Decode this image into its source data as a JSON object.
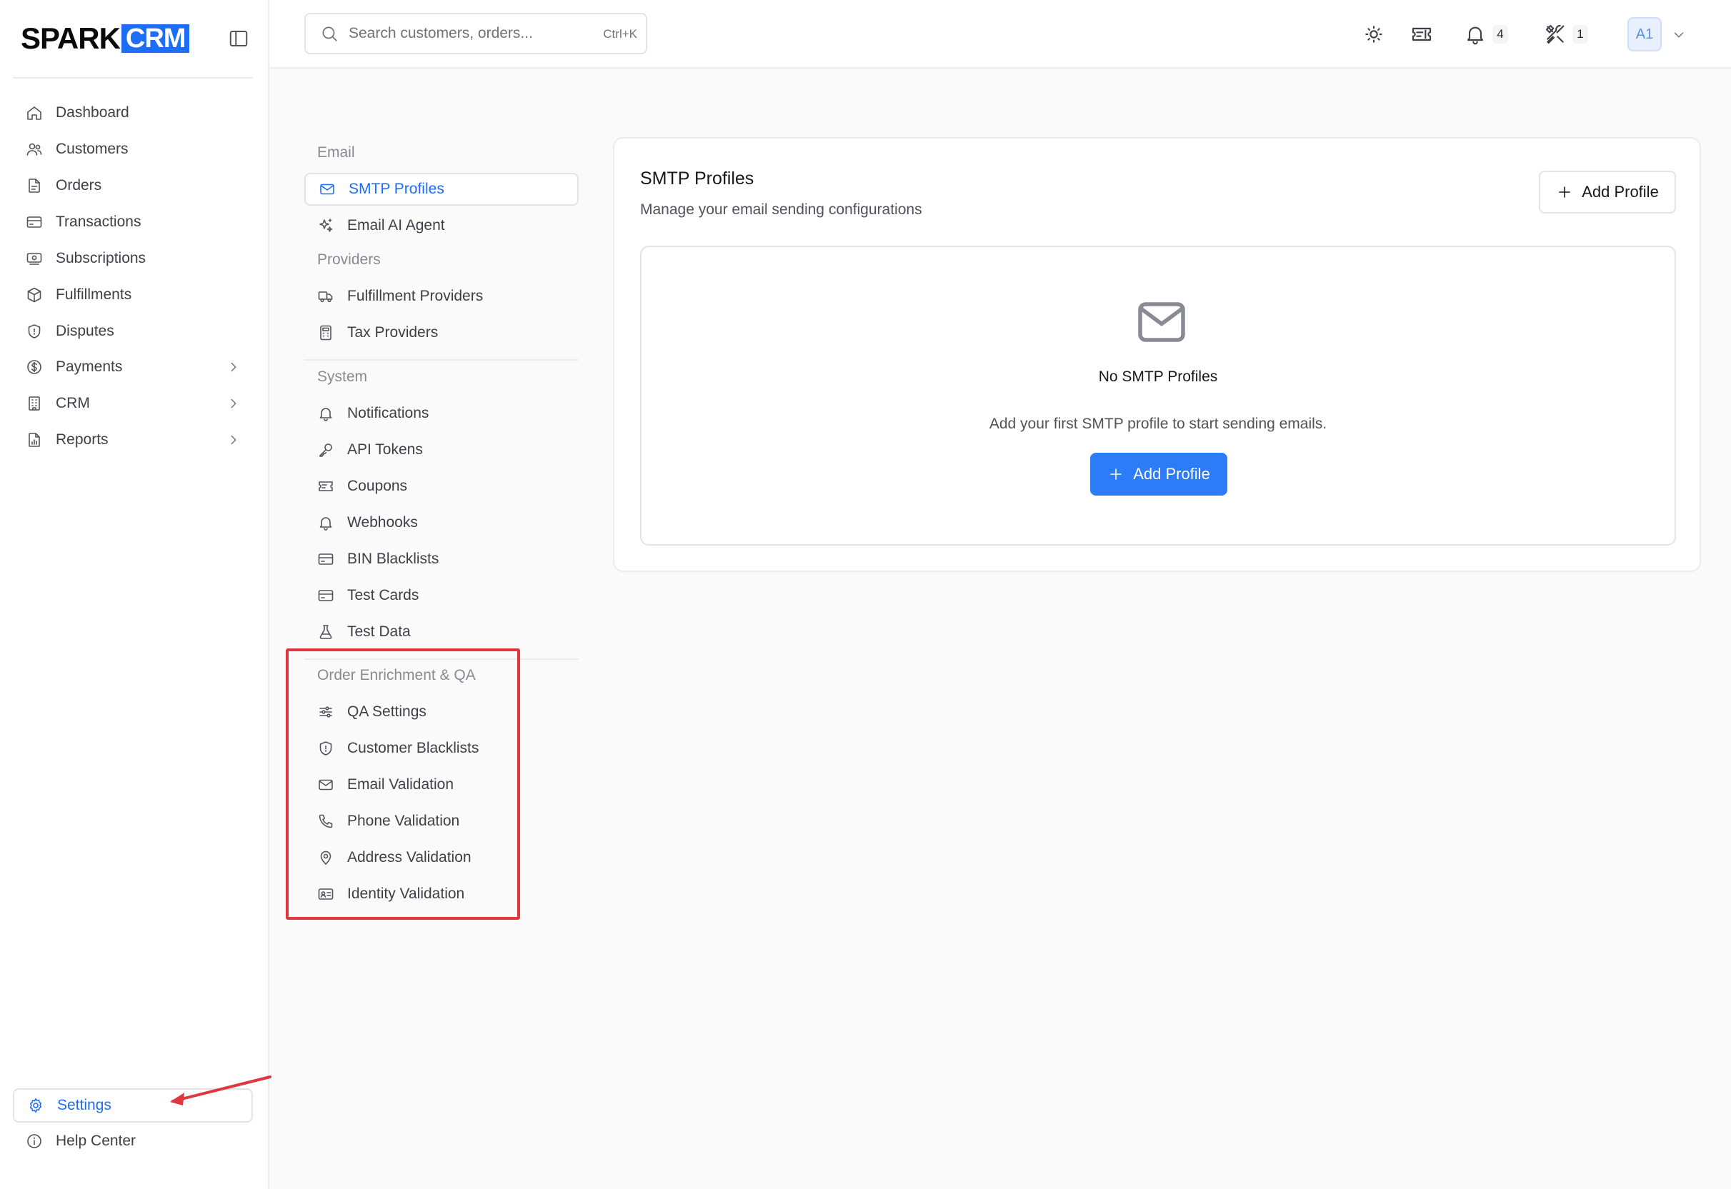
{
  "brand": {
    "name_part1": "SPARK",
    "name_part2": "CRM",
    "accent_color": "#1d6ef5"
  },
  "sidebar": {
    "toggle_icon": "sidebar-toggle-icon",
    "items": [
      {
        "label": "Dashboard",
        "icon": "home-icon"
      },
      {
        "label": "Customers",
        "icon": "users-icon"
      },
      {
        "label": "Orders",
        "icon": "file-icon"
      },
      {
        "label": "Transactions",
        "icon": "credit-card-icon"
      },
      {
        "label": "Subscriptions",
        "icon": "subscription-icon"
      },
      {
        "label": "Fulfillments",
        "icon": "package-icon"
      },
      {
        "label": "Disputes",
        "icon": "shield-icon"
      },
      {
        "label": "Payments",
        "icon": "dollar-icon",
        "has_submenu": true
      },
      {
        "label": "CRM",
        "icon": "building-icon",
        "has_submenu": true
      },
      {
        "label": "Reports",
        "icon": "report-icon",
        "has_submenu": true
      }
    ],
    "bottom_items": [
      {
        "label": "Settings",
        "icon": "gear-icon",
        "active": true
      },
      {
        "label": "Help Center",
        "icon": "info-icon"
      }
    ]
  },
  "header": {
    "search": {
      "placeholder": "Search customers, orders...",
      "shortcut": "Ctrl+K"
    },
    "theme_icon": "sun-icon",
    "ticket_icon": "ticket-icon",
    "notifications": {
      "icon": "bell-icon",
      "count": "4"
    },
    "tools": {
      "icon": "tools-icon",
      "count": "1"
    },
    "user": {
      "initials": "A1"
    }
  },
  "settings_nav": {
    "sections": [
      {
        "title": "Email",
        "items": [
          {
            "label": "SMTP Profiles",
            "icon": "mail-icon",
            "active": true
          },
          {
            "label": "Email AI Agent",
            "icon": "sparkles-icon"
          }
        ]
      },
      {
        "title": "Providers",
        "items": [
          {
            "label": "Fulfillment Providers",
            "icon": "truck-icon"
          },
          {
            "label": "Tax Providers",
            "icon": "calculator-icon"
          }
        ]
      },
      {
        "title": "System",
        "items": [
          {
            "label": "Notifications",
            "icon": "bell-icon"
          },
          {
            "label": "API Tokens",
            "icon": "key-icon"
          },
          {
            "label": "Coupons",
            "icon": "ticket-icon"
          },
          {
            "label": "Webhooks",
            "icon": "webhook-icon"
          },
          {
            "label": "BIN Blacklists",
            "icon": "credit-card-icon"
          },
          {
            "label": "Test Cards",
            "icon": "credit-card-icon"
          },
          {
            "label": "Test Data",
            "icon": "flask-icon"
          }
        ]
      },
      {
        "title": "Order Enrichment & QA",
        "items": [
          {
            "label": "QA Settings",
            "icon": "sliders-icon"
          },
          {
            "label": "Customer Blacklists",
            "icon": "shield-alert-icon"
          },
          {
            "label": "Email Validation",
            "icon": "mail-icon"
          },
          {
            "label": "Phone Validation",
            "icon": "phone-icon"
          },
          {
            "label": "Address Validation",
            "icon": "map-pin-icon"
          },
          {
            "label": "Identity Validation",
            "icon": "id-card-icon"
          }
        ]
      }
    ]
  },
  "main": {
    "title": "SMTP Profiles",
    "subtitle": "Manage your email sending configurations",
    "add_button_label": "Add Profile",
    "empty_state": {
      "icon": "mail-icon",
      "title": "No SMTP Profiles",
      "description": "Add your first SMTP profile to start sending emails.",
      "button_label": "Add Profile"
    }
  },
  "annotations": {
    "highlight_color": "#e0373c"
  }
}
